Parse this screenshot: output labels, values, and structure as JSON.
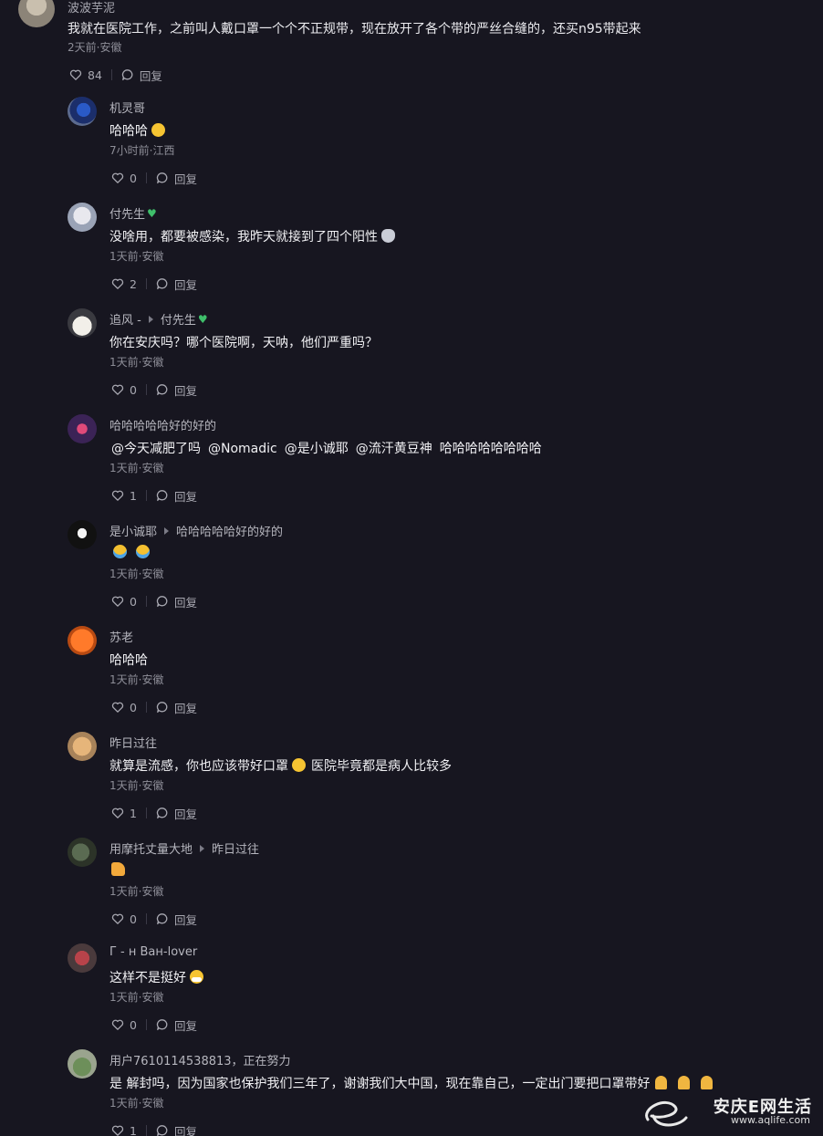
{
  "top_comment": {
    "username": "波波芋泥",
    "text": "我就在医院工作，之前叫人戴口罩一个个不正规带，现在放开了各个带的严丝合缝的，还买n95带起来",
    "meta": "2天前·安徽",
    "likes": "84",
    "reply_label": "回复"
  },
  "replies": [
    {
      "username": "机灵哥",
      "reply_to": "",
      "text": "哈哈哈",
      "emoji": "laugh",
      "meta": "7小时前·江西",
      "likes": "0",
      "reply_label": "回复"
    },
    {
      "username": "付先生",
      "reply_to": "",
      "text": "没啥用，都要被感染，我昨天就接到了四个阳性",
      "emoji": "cat",
      "meta": "1天前·安徽",
      "likes": "2",
      "reply_label": "回复"
    },
    {
      "username": "追风 -",
      "reply_to": "付先生",
      "text": "你在安庆吗？哪个医院啊，天呐，他们严重吗？",
      "emoji": "",
      "meta": "1天前·安徽",
      "likes": "0",
      "reply_label": "回复"
    },
    {
      "username": "哈哈哈哈哈好的好的",
      "reply_to": "",
      "mentions": [
        "@今天减肥了吗",
        "@Nomadic",
        "@是小诚耶",
        "@流汗黄豆神"
      ],
      "text": "哈哈哈哈哈哈哈哈",
      "meta": "1天前·安徽",
      "likes": "1",
      "reply_label": "回复"
    },
    {
      "username": "是小诚耶",
      "reply_to": "哈哈哈哈哈好的好的",
      "text": "",
      "emoji": "cry2",
      "meta": "1天前·安徽",
      "likes": "0",
      "reply_label": "回复"
    },
    {
      "username": "苏老",
      "reply_to": "",
      "text": "哈哈哈",
      "emoji": "",
      "meta": "1天前·安徽",
      "likes": "0",
      "reply_label": "回复"
    },
    {
      "username": "昨日过往",
      "reply_to": "",
      "text": "就算是流感，你也应该带好口罩",
      "text2": "医院毕竟都是病人比较多",
      "emoji": "laugh-mid",
      "meta": "1天前·安徽",
      "likes": "1",
      "reply_label": "回复"
    },
    {
      "username": "用摩托丈量大地",
      "reply_to": "昨日过往",
      "text": "",
      "emoji": "thumb",
      "meta": "1天前·安徽",
      "likes": "0",
      "reply_label": "回复"
    },
    {
      "username": "Г - н Ван-lover",
      "reply_to": "",
      "text": "这样不是挺好",
      "emoji": "mask",
      "meta": "1天前·安徽",
      "likes": "0",
      "reply_label": "回复"
    },
    {
      "username": "用户7610114538813，正在努力",
      "reply_to": "",
      "text": "是 解封吗，因为国家也保护我们三年了，谢谢我们大中国，现在靠自己，一定出门要把口罩带好",
      "emoji": "pray3",
      "meta": "1天前·安徽",
      "likes": "1",
      "reply_label": "回复"
    }
  ],
  "watermark": {
    "brand": "安庆E网生活",
    "url": "www.aqlife.com"
  },
  "colors": {
    "background": "#171620",
    "verified_heart": "#3fbf6b"
  }
}
